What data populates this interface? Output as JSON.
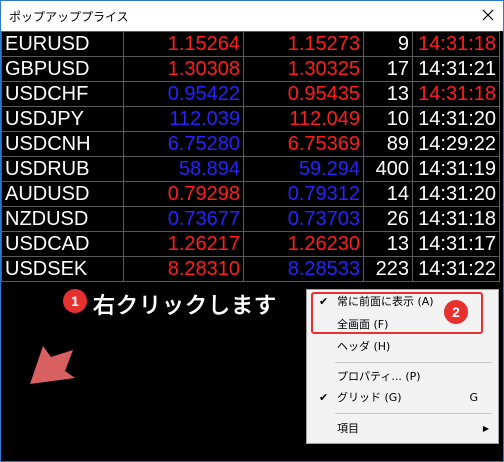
{
  "window": {
    "title": "ポップアッププライス"
  },
  "quotes": [
    {
      "symbol": "EURUSD",
      "bid": "1.15264",
      "ask": "1.15273",
      "count": "9",
      "time": "14:31:18",
      "bid_color": "red",
      "ask_color": "red",
      "time_color": "red"
    },
    {
      "symbol": "GBPUSD",
      "bid": "1.30308",
      "ask": "1.30325",
      "count": "17",
      "time": "14:31:21",
      "bid_color": "red",
      "ask_color": "red",
      "time_color": "white"
    },
    {
      "symbol": "USDCHF",
      "bid": "0.95422",
      "ask": "0.95435",
      "count": "13",
      "time": "14:31:18",
      "bid_color": "blue",
      "ask_color": "red",
      "time_color": "red"
    },
    {
      "symbol": "USDJPY",
      "bid": "112.039",
      "ask": "112.049",
      "count": "10",
      "time": "14:31:20",
      "bid_color": "blue",
      "ask_color": "red",
      "time_color": "white"
    },
    {
      "symbol": "USDCNH",
      "bid": "6.75280",
      "ask": "6.75369",
      "count": "89",
      "time": "14:29:22",
      "bid_color": "blue",
      "ask_color": "red",
      "time_color": "white"
    },
    {
      "symbol": "USDRUB",
      "bid": "58.894",
      "ask": "59.294",
      "count": "400",
      "time": "14:31:19",
      "bid_color": "blue",
      "ask_color": "blue",
      "time_color": "white"
    },
    {
      "symbol": "AUDUSD",
      "bid": "0.79298",
      "ask": "0.79312",
      "count": "14",
      "time": "14:31:20",
      "bid_color": "red",
      "ask_color": "blue",
      "time_color": "white"
    },
    {
      "symbol": "NZDUSD",
      "bid": "0.73677",
      "ask": "0.73703",
      "count": "26",
      "time": "14:31:18",
      "bid_color": "blue",
      "ask_color": "blue",
      "time_color": "white"
    },
    {
      "symbol": "USDCAD",
      "bid": "1.26217",
      "ask": "1.26230",
      "count": "13",
      "time": "14:31:17",
      "bid_color": "red",
      "ask_color": "red",
      "time_color": "white"
    },
    {
      "symbol": "USDSEK",
      "bid": "8.28310",
      "ask": "8.28533",
      "count": "223",
      "time": "14:31:22",
      "bid_color": "red",
      "ask_color": "blue",
      "time_color": "white"
    }
  ],
  "annotation": {
    "step1_number": "1",
    "step1_text": "右クリックします",
    "step2_number": "2"
  },
  "context_menu": {
    "always_on_top": {
      "label": "常に前面に表示 (A)",
      "checked": true
    },
    "fullscreen": {
      "label": "全画面 (F)"
    },
    "header": {
      "label": "ヘッダ (H)"
    },
    "properties": {
      "label": "プロパティ... (P)"
    },
    "grid": {
      "label": "グリッド (G)",
      "shortcut": "G",
      "checked": true
    },
    "items": {
      "label": "項目"
    },
    "check_mark": "✔",
    "submenu_arrow": "▶"
  },
  "colors": {
    "red": "#ff1e1e",
    "blue": "#2424ff",
    "white": "#ffffff",
    "annotation": "#e8312f"
  }
}
